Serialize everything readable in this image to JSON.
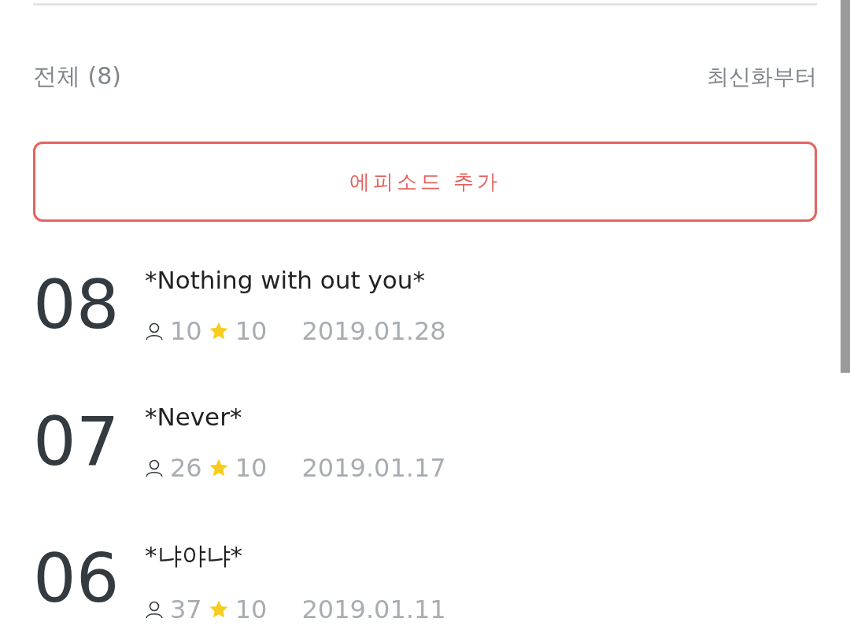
{
  "summary": {
    "total": "전체 (8)",
    "sort": "최신화부터"
  },
  "add_button": "에피소드 추가",
  "episodes": [
    {
      "number": "08",
      "title": "*Nothing with out you*",
      "views": "10",
      "rating": "10",
      "date": "2019.01.28"
    },
    {
      "number": "07",
      "title": "*Never*",
      "views": "26",
      "rating": "10",
      "date": "2019.01.17"
    },
    {
      "number": "06",
      "title": "*냐야냐*",
      "views": "37",
      "rating": "10",
      "date": "2019.01.11"
    }
  ]
}
